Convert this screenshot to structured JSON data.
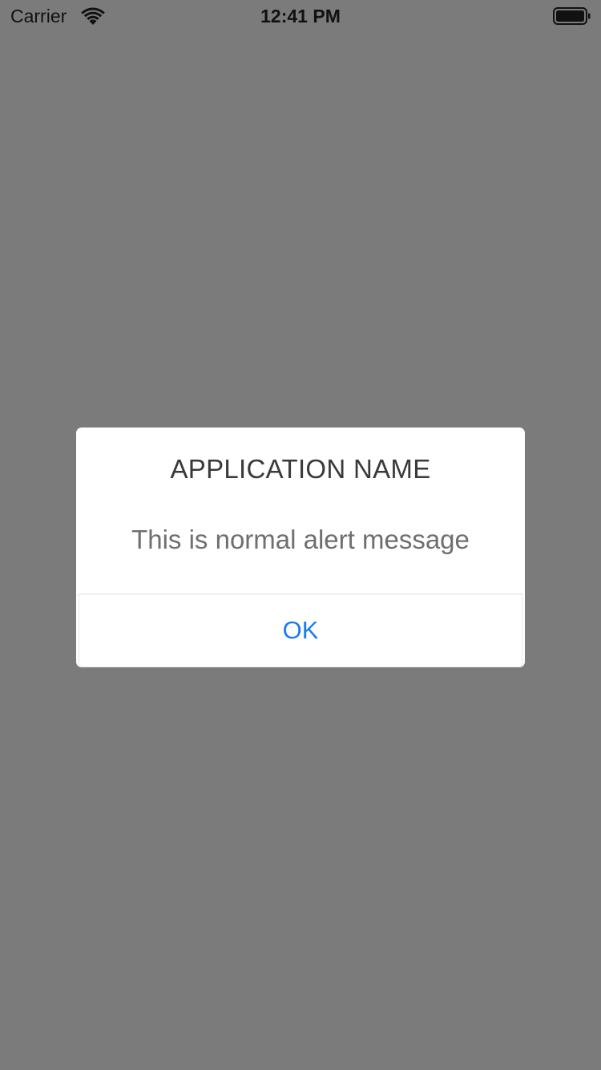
{
  "status_bar": {
    "carrier": "Carrier",
    "time": "12:41 PM",
    "wifi_icon": "wifi-icon",
    "battery_icon": "battery-icon"
  },
  "alert": {
    "title": "APPLICATION NAME",
    "message": "This is normal alert message",
    "ok_label": "OK",
    "accent_color": "#1a7cf0"
  },
  "colors": {
    "backdrop": "#7b7b7b",
    "alert_background": "#ffffff"
  }
}
